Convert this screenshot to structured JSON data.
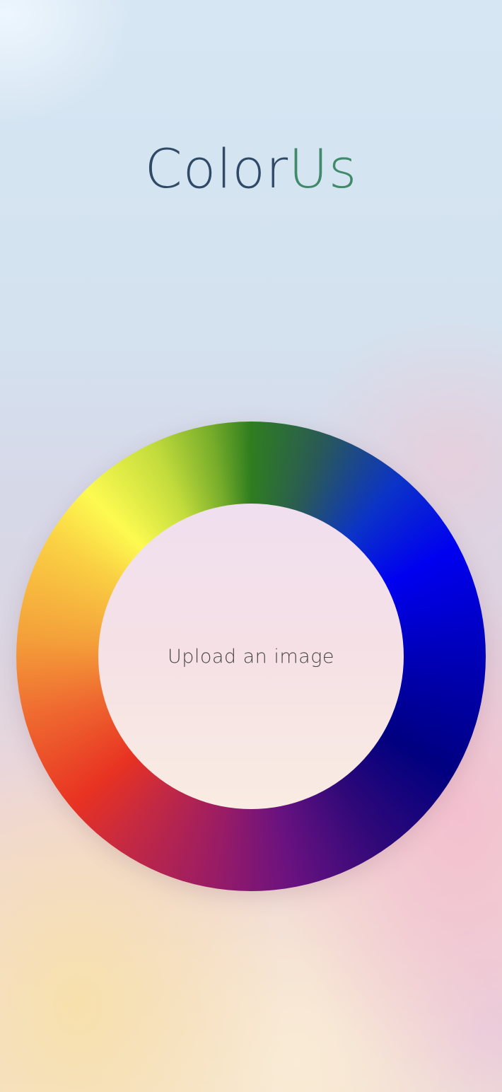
{
  "app": {
    "title_part1": "Color",
    "title_part2": "Us",
    "title_colors": {
      "part1": "#2e4a66",
      "part2": "#3f8a6a"
    }
  },
  "uploader": {
    "label": "Upload an image",
    "wheel_icon": "color-wheel-icon"
  }
}
